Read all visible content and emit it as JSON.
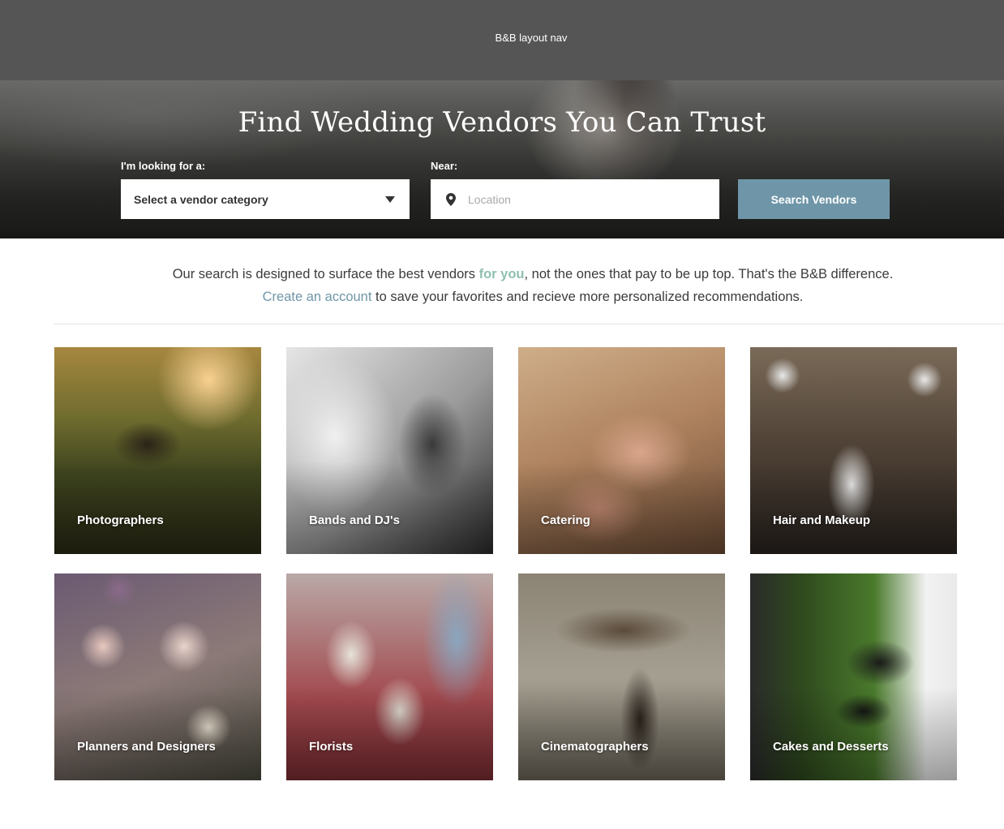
{
  "nav": {
    "label": "B&B layout nav"
  },
  "hero": {
    "title": "Find Wedding Vendors You Can Trust",
    "category_label": "I'm looking for a:",
    "category_value": "Select a vendor category",
    "near_label": "Near:",
    "location_placeholder": "Location",
    "search_button": "Search Vendors"
  },
  "intro": {
    "line1_before": "Our search is designed to surface the best vendors ",
    "line1_accent": "for you",
    "line1_after": ", not the ones that pay to be up top. That's the B&B difference.",
    "line2_link": "Create an account",
    "line2_after": " to save your favorites and recieve more personalized recommendations."
  },
  "categories": [
    {
      "label": "Photographers"
    },
    {
      "label": "Bands and DJ's"
    },
    {
      "label": "Catering"
    },
    {
      "label": "Hair and Makeup"
    },
    {
      "label": "Planners and Designers"
    },
    {
      "label": "Florists"
    },
    {
      "label": "Cinematographers"
    },
    {
      "label": "Cakes and Desserts"
    }
  ],
  "colors": {
    "nav_bg": "#555555",
    "button": "#6f96a8",
    "accent": "#8fc0ae",
    "link": "#6f96a8"
  },
  "icons": {
    "location": "map-pin-icon",
    "dropdown": "caret-down-icon"
  }
}
